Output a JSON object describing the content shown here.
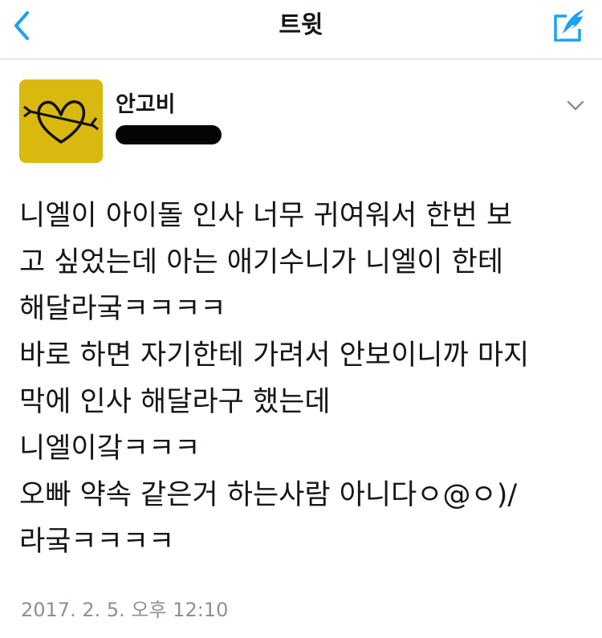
{
  "navbar": {
    "title": "트윗",
    "back_icon": "chevron-left-icon",
    "compose_icon": "compose-quill-icon",
    "accent_color": "#1da1f2"
  },
  "tweet": {
    "author": {
      "display_name": "안고비",
      "avatar_icon": "heart-arrow-drawing",
      "avatar_bg": "#d9b80f"
    },
    "caret_icon": "chevron-down-icon",
    "lines": [
      "니엘이 아이돌 인사 너무 귀여워서 한번 보",
      "고 싶었는데 아는 애기수니가 니엘이 한테",
      "해달라궄ㅋㅋㅋㅋ",
      "바로 하면 자기한테 가려서 안보이니까 마지",
      "막에 인사 해달라구 했는데",
      "니엘이갘ㅋㅋㅋ",
      "오빠 약속 같은거 하는사람 아니다ㅇ@ㅇ)/",
      "라궄ㅋㅋㅋㅋ"
    ],
    "timestamp": "2017. 2. 5. 오후 12:10"
  }
}
